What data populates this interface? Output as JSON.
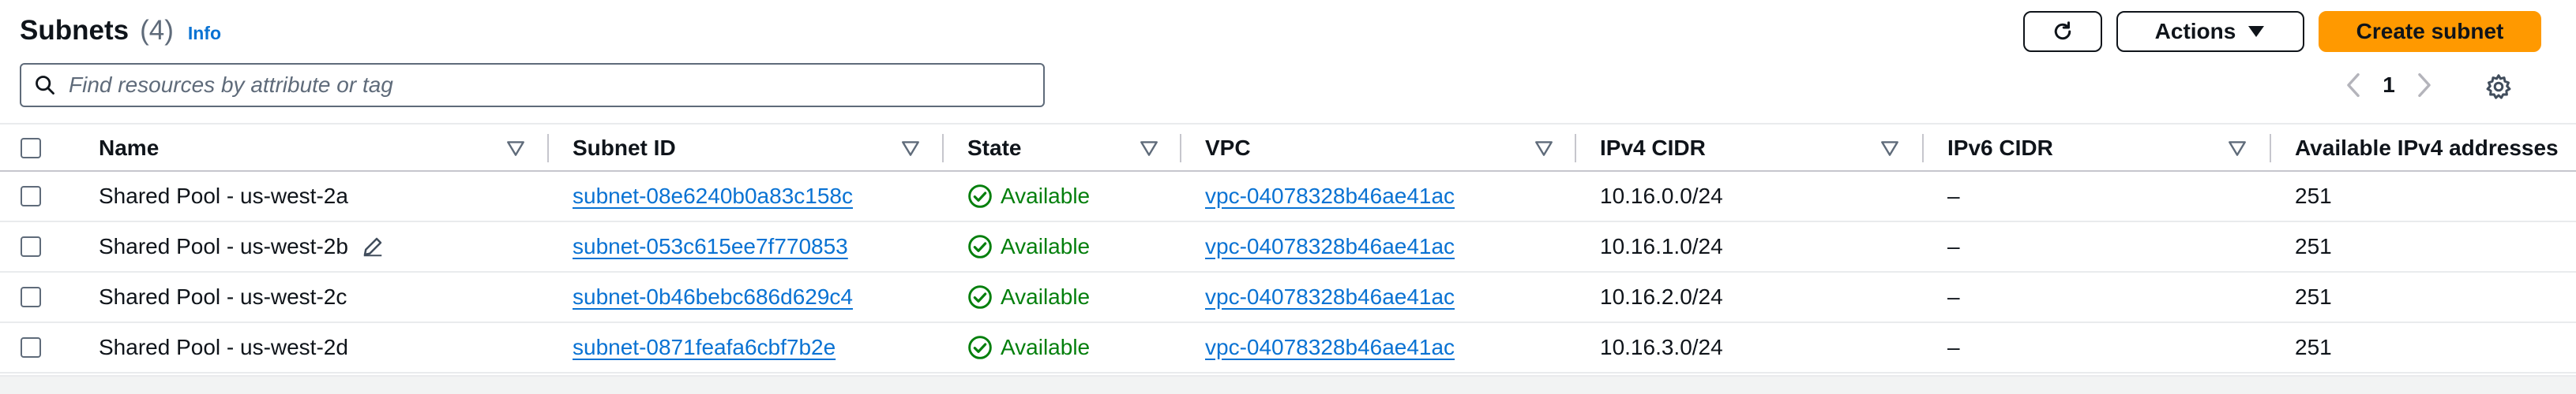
{
  "header": {
    "title": "Subnets",
    "count": "(4)",
    "info_label": "Info"
  },
  "toolbar": {
    "actions_label": "Actions",
    "create_label": "Create subnet"
  },
  "search": {
    "placeholder": "Find resources by attribute or tag"
  },
  "pagination": {
    "current_page": "1"
  },
  "table": {
    "columns": [
      "Name",
      "Subnet ID",
      "State",
      "VPC",
      "IPv4 CIDR",
      "IPv6 CIDR",
      "Available IPv4 addresses"
    ],
    "rows": [
      {
        "name": "Shared Pool - us-west-2a",
        "subnet_id": "subnet-08e6240b0a83c158c",
        "state": "Available",
        "vpc": "vpc-04078328b46ae41ac",
        "ipv4": "10.16.0.0/24",
        "ipv6": "–",
        "available": "251"
      },
      {
        "name": "Shared Pool - us-west-2b",
        "subnet_id": "subnet-053c615ee7f770853",
        "state": "Available",
        "vpc": "vpc-04078328b46ae41ac",
        "ipv4": "10.16.1.0/24",
        "ipv6": "–",
        "available": "251"
      },
      {
        "name": "Shared Pool - us-west-2c",
        "subnet_id": "subnet-0b46bebc686d629c4",
        "state": "Available",
        "vpc": "vpc-04078328b46ae41ac",
        "ipv4": "10.16.2.0/24",
        "ipv6": "–",
        "available": "251"
      },
      {
        "name": "Shared Pool - us-west-2d",
        "subnet_id": "subnet-0871feafa6cbf7b2e",
        "state": "Available",
        "vpc": "vpc-04078328b46ae41ac",
        "ipv4": "10.16.3.0/24",
        "ipv6": "–",
        "available": "251"
      }
    ]
  },
  "icons": {
    "refresh": "refresh-icon",
    "actions_caret": "caret-down-icon",
    "search": "search-icon",
    "prev": "chevron-left-icon",
    "next": "chevron-right-icon",
    "settings": "gear-icon",
    "sort": "sort-caret-down-icon",
    "status_ok": "check-circle-icon",
    "edit": "pencil-icon"
  },
  "colors": {
    "primary_button": "#ff9900",
    "link": "#0972d3",
    "success": "#037f0c",
    "text": "#0f141a",
    "secondary_text": "#5f6b7a"
  }
}
